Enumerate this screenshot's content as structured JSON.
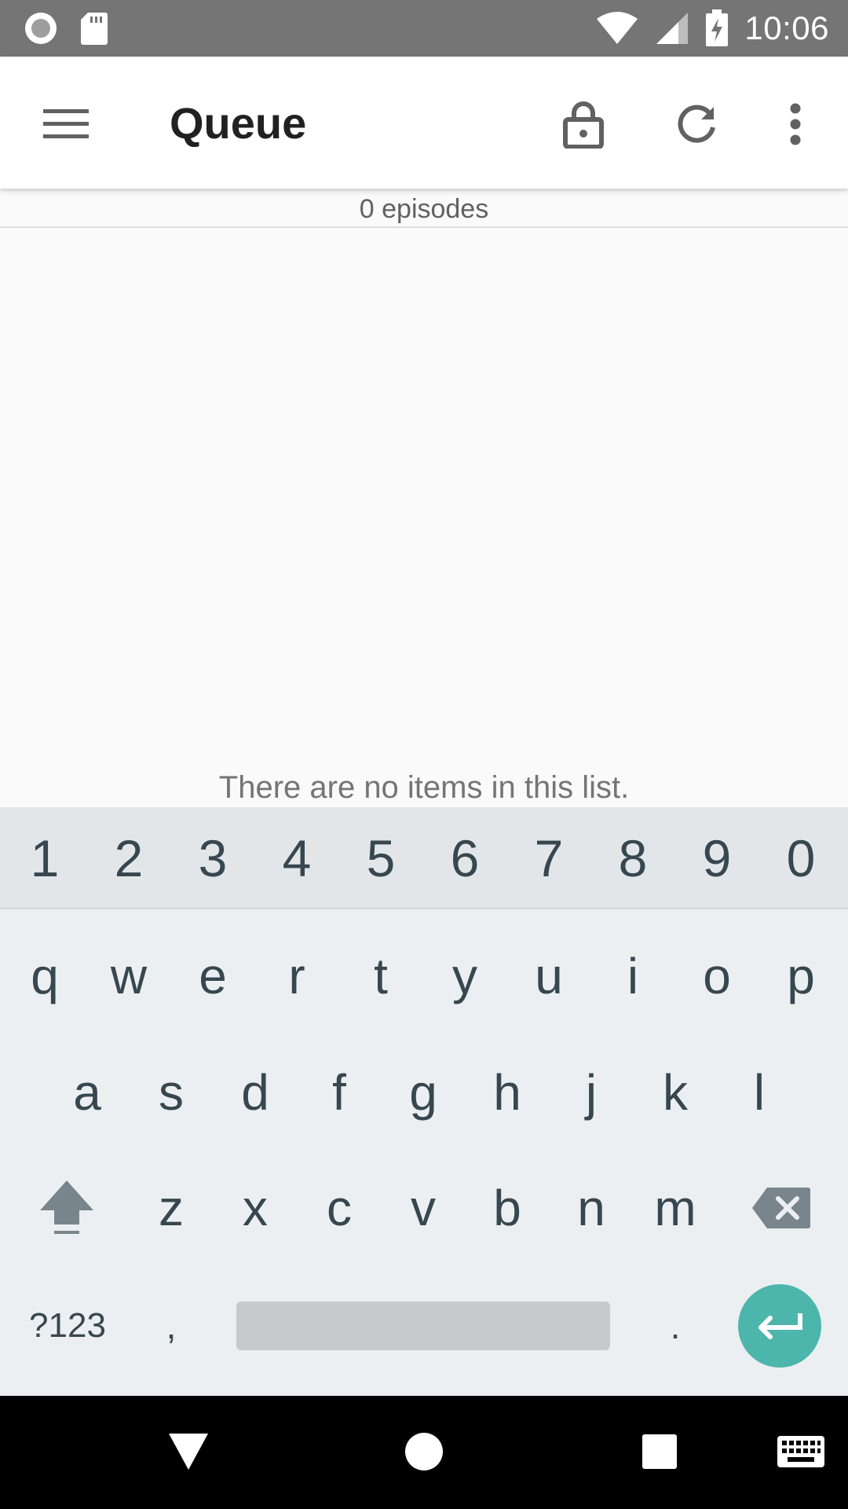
{
  "status_bar": {
    "time": "10:06",
    "left_icons": [
      "record-icon",
      "sd-card-icon"
    ],
    "right_icons": [
      "wifi-icon",
      "cell-signal-icon",
      "battery-charging-icon"
    ]
  },
  "toolbar": {
    "title": "Queue",
    "actions": [
      "menu-icon",
      "lock-icon",
      "refresh-icon",
      "more-vert-icon"
    ]
  },
  "queue": {
    "episode_count": "0 episodes",
    "empty_message": "There are no items in this list."
  },
  "keyboard": {
    "number_row": [
      "1",
      "2",
      "3",
      "4",
      "5",
      "6",
      "7",
      "8",
      "9",
      "0"
    ],
    "row1": [
      "q",
      "w",
      "e",
      "r",
      "t",
      "y",
      "u",
      "i",
      "o",
      "p"
    ],
    "row2": [
      "a",
      "s",
      "d",
      "f",
      "g",
      "h",
      "j",
      "k",
      "l"
    ],
    "row3": [
      "z",
      "x",
      "c",
      "v",
      "b",
      "n",
      "m"
    ],
    "symbols_label": "?123",
    "comma_label": ",",
    "period_label": ".",
    "accent_color": "#4db6ac"
  },
  "nav_bar": {
    "buttons": [
      "back-icon",
      "home-icon",
      "recents-icon",
      "keyboard-icon"
    ]
  }
}
